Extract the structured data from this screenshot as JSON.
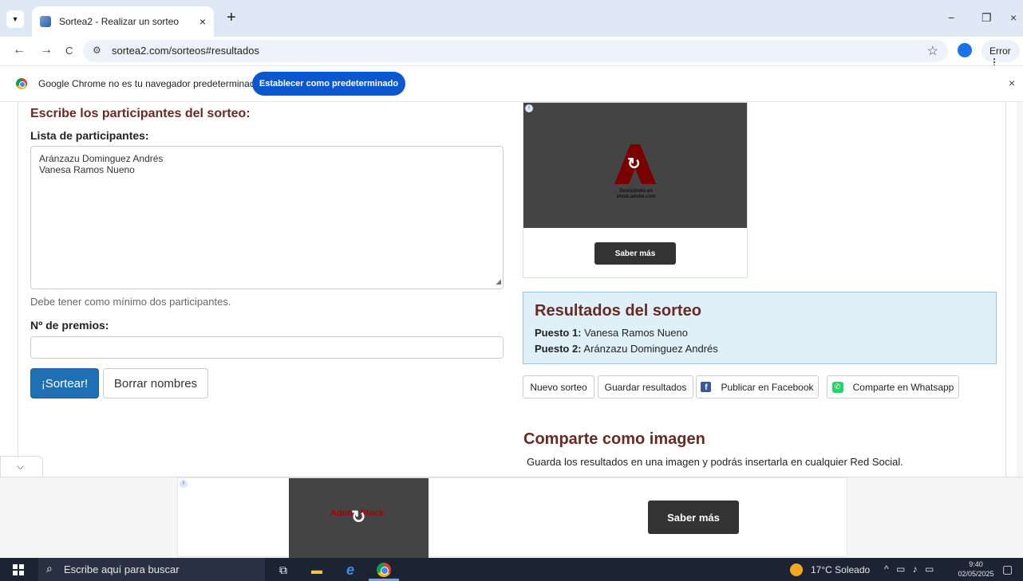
{
  "browser": {
    "tab_title": "Sortea2 - Realizar un sorteo",
    "tab_close": "×",
    "new_tab": "+",
    "url": "sortea2.com/sorteos#resultados",
    "profile_status": "Error",
    "win_minimize": "−",
    "win_restore": "❐",
    "win_close": "×",
    "icons": {
      "back": "←",
      "forward": "→",
      "reload": "C",
      "star": "☆",
      "menu": "⋮",
      "site_info": "⚙"
    }
  },
  "infobar": {
    "message": "Google Chrome no es tu navegador predeterminado",
    "button": "Establecer como predeterminado",
    "close": "×"
  },
  "form": {
    "heading": "Escribe los participantes del sorteo:",
    "list_label": "Lista de participantes:",
    "participants": [
      "Aránzazu Dominguez Andrés",
      " Vanesa Ramos Nueno"
    ],
    "help": "Debe tener como mínimo dos participantes.",
    "prizes_label": "Nº de premios:",
    "prizes_value": "",
    "draw_button": "¡Sortear!",
    "clear_button": "Borrar nombres"
  },
  "side_ad": {
    "caption": "Descúbrelo en stock.adobe.com",
    "button": "Saber más"
  },
  "results": {
    "title": "Resultados del sorteo",
    "rows": [
      {
        "label": "Puesto 1:",
        "value": " Vanesa Ramos Nueno"
      },
      {
        "label": "Puesto 2:",
        "value": " Aránzazu Dominguez Andrés"
      }
    ]
  },
  "actions": {
    "new": "Nuevo sorteo",
    "save": "Guardar resultados",
    "facebook": "Publicar en Facebook",
    "whatsapp": "Comparte en Whatsapp"
  },
  "share": {
    "title": "Comparte como imagen",
    "text": "Guarda los resultados en una imagen y podrás insertarla en cualquier Red Social."
  },
  "bottom_ad": {
    "logo": "Adobe Stock",
    "button": "Saber más"
  },
  "taskbar": {
    "search_placeholder": "Escribe aquí para buscar",
    "weather": "17°C Soleado",
    "time": "9:40",
    "date": "02/05/2025"
  },
  "colors": {
    "accent": "#1f6fb5",
    "heading": "#6a2a22",
    "results_bg": "#dff0f8",
    "chrome_blue": "#0b57d0"
  }
}
